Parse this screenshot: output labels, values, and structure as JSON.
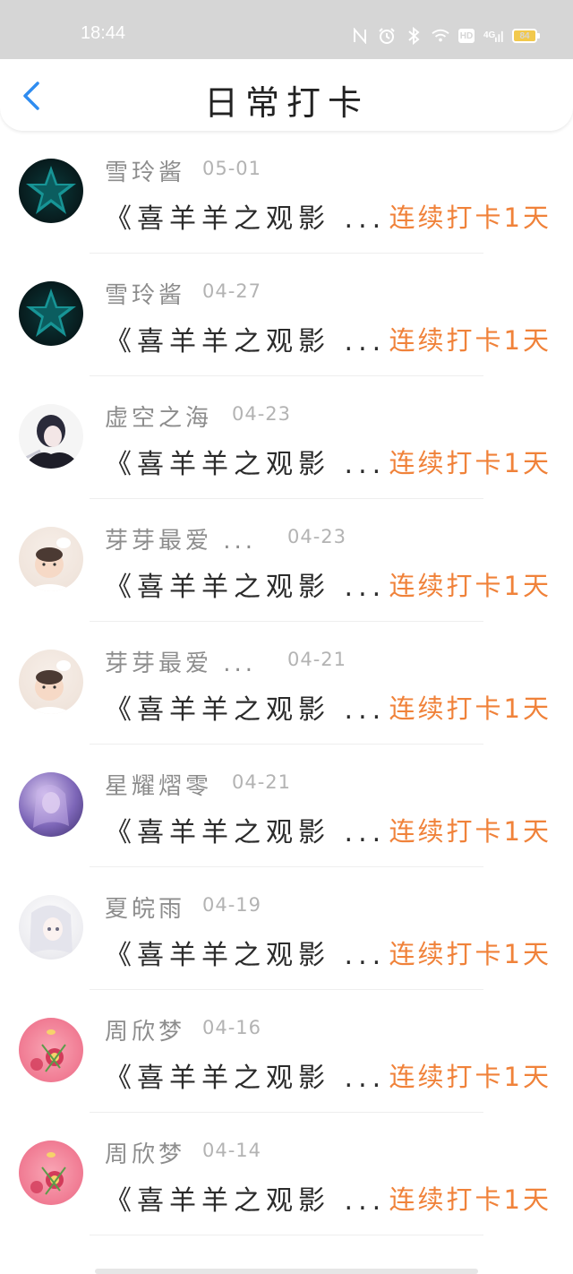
{
  "status_bar": {
    "time": "18:44",
    "network_label": "4G",
    "hd_label": "HD",
    "battery_level": "84",
    "icons": [
      "nfc-icon",
      "alarm-icon",
      "bluetooth-icon",
      "wifi-icon",
      "hd-icon",
      "signal-icon",
      "battery-icon"
    ]
  },
  "header": {
    "title": "日常打卡",
    "back_icon": "chevron-left-icon",
    "accent_color": "#2f8cf0"
  },
  "colors": {
    "name": "#8d8d8d",
    "date": "#b3b3b3",
    "title": "#2b2b2b",
    "streak": "#f0823a"
  },
  "items": [
    {
      "name": "雪玲酱",
      "date": "05-01",
      "title": "《喜羊羊之观影 ...",
      "streak": "连续打卡1天",
      "avatar": "star-avatar"
    },
    {
      "name": "雪玲酱",
      "date": "04-27",
      "title": "《喜羊羊之观影 ...",
      "streak": "连续打卡1天",
      "avatar": "star-avatar"
    },
    {
      "name": "虚空之海",
      "date": "04-23",
      "title": "《喜羊羊之观影 ...",
      "streak": "连续打卡1天",
      "avatar": "anime-boy-avatar"
    },
    {
      "name": "芽芽最爱 ...",
      "date": "04-23",
      "title": "《喜羊羊之观影 ...",
      "streak": "连续打卡1天",
      "avatar": "baby-avatar"
    },
    {
      "name": "芽芽最爱 ...",
      "date": "04-21",
      "title": "《喜羊羊之观影 ...",
      "streak": "连续打卡1天",
      "avatar": "baby-avatar"
    },
    {
      "name": "星耀熠零",
      "date": "04-21",
      "title": "《喜羊羊之观影 ...",
      "streak": "连续打卡1天",
      "avatar": "purple-avatar"
    },
    {
      "name": "夏皖雨",
      "date": "04-19",
      "title": "《喜羊羊之观影 ...",
      "streak": "连续打卡1天",
      "avatar": "white-hair-avatar"
    },
    {
      "name": "周欣梦",
      "date": "04-16",
      "title": "《喜羊羊之观影 ...",
      "streak": "连续打卡1天",
      "avatar": "pink-flower-avatar"
    },
    {
      "name": "周欣梦",
      "date": "04-14",
      "title": "《喜羊羊之观影 ...",
      "streak": "连续打卡1天",
      "avatar": "pink-flower-avatar"
    }
  ]
}
